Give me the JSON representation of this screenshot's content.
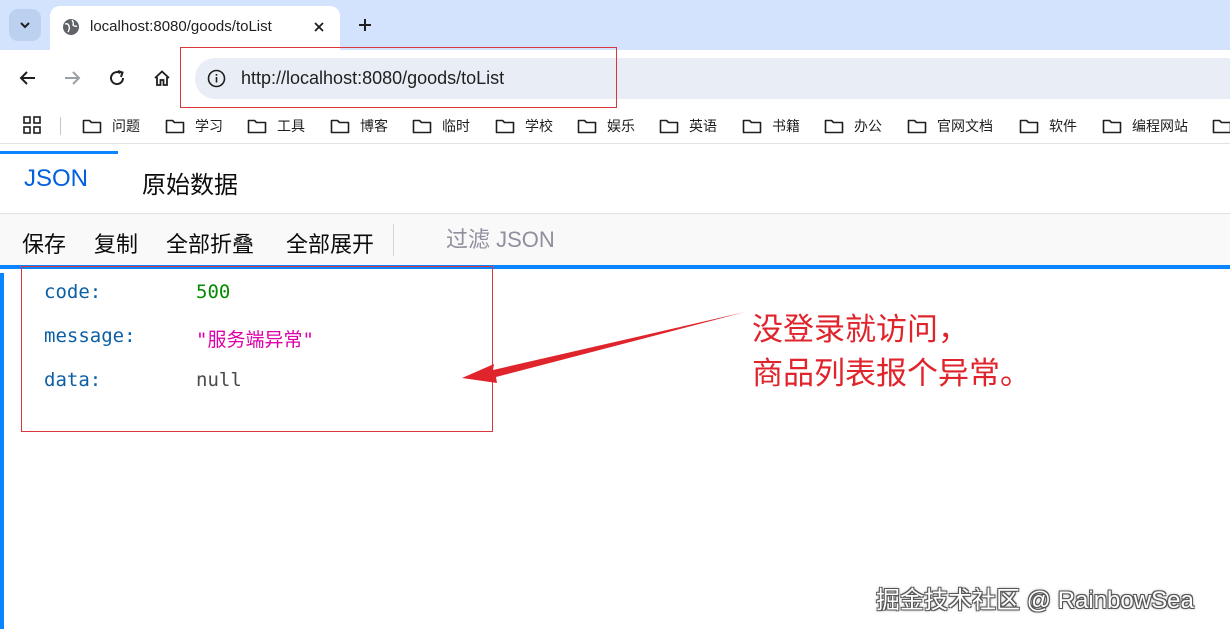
{
  "browser": {
    "tab_title": "localhost:8080/goods/toList",
    "url": "http://localhost:8080/goods/toList",
    "bookmarks": [
      "问题",
      "学习",
      "工具",
      "博客",
      "临时",
      "学校",
      "娱乐",
      "英语",
      "书籍",
      "办公",
      "官网文档",
      "软件",
      "编程网站"
    ]
  },
  "viewer": {
    "tabs": {
      "json": "JSON",
      "raw": "原始数据"
    },
    "actions": {
      "save": "保存",
      "copy": "复制",
      "collapse_all": "全部折叠",
      "expand_all": "全部展开"
    },
    "filter_placeholder": "过滤 JSON"
  },
  "json_rows": [
    {
      "key": "code:",
      "value": "500",
      "type": "number"
    },
    {
      "key": "message:",
      "value": "\"服务端异常\"",
      "type": "string"
    },
    {
      "key": "data:",
      "value": "null",
      "type": "null"
    }
  ],
  "annotation": {
    "line1": "没登录就访问，",
    "line2": "商品列表报个异常。"
  },
  "watermark": "掘金技术社区 @ RainbowSea",
  "colors": {
    "accent": "#0a84ff",
    "annotation_red": "#e0242b",
    "json_key": "#0b5fa5",
    "json_number": "#058b00",
    "json_string": "#dd00a9"
  }
}
